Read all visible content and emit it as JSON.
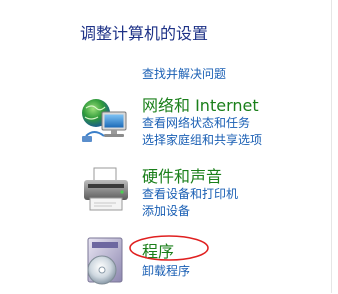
{
  "title": "调整计算机的设置",
  "top_link": "查找并解决问题",
  "categories": {
    "network": {
      "heading": "网络和 Internet",
      "links": [
        "查看网络状态和任务",
        "选择家庭组和共享选项"
      ],
      "icon": "network-globe-icon"
    },
    "hardware": {
      "heading": "硬件和声音",
      "links": [
        "查看设备和打印机",
        "添加设备"
      ],
      "icon": "printer-icon"
    },
    "programs": {
      "heading": "程序",
      "links": [
        "卸载程序"
      ],
      "icon": "programs-disc-icon"
    }
  },
  "colors": {
    "title": "#1e3287",
    "link": "#1a5fb4",
    "heading": "#1a7f1a",
    "annotation": "#e02020"
  }
}
